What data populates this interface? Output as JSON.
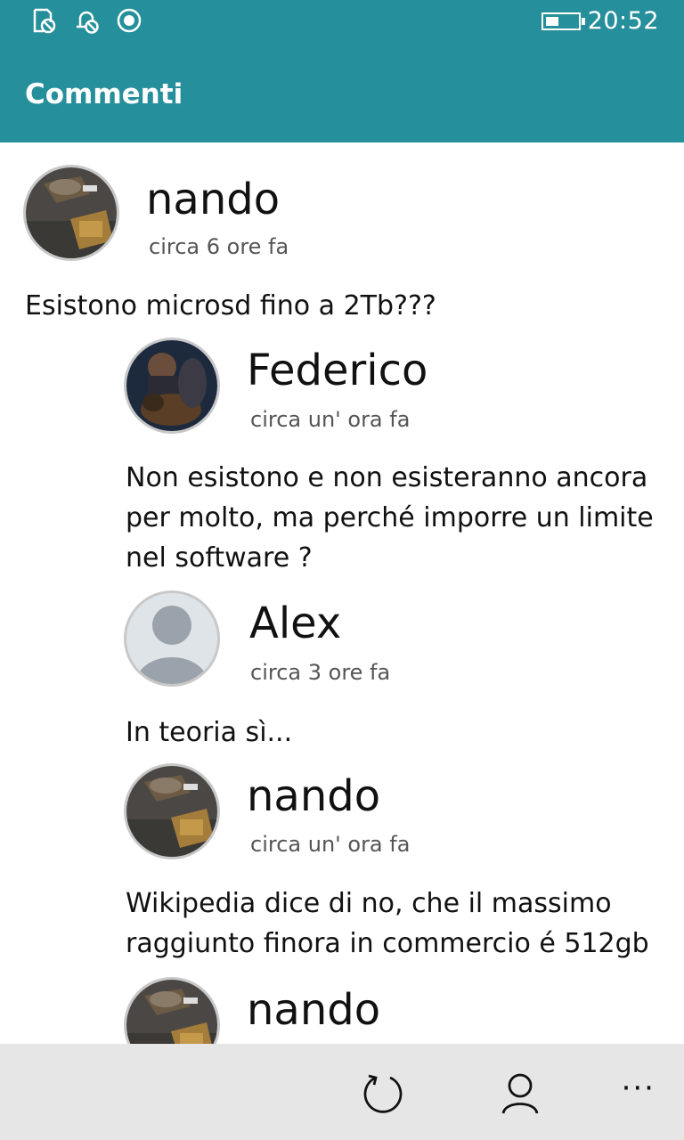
{
  "status_bar": {
    "time": "20:52",
    "icons": [
      "alarm-off-icon",
      "notification-off-icon",
      "record-icon",
      "battery-icon"
    ]
  },
  "app_bar": {
    "title": "Commenti"
  },
  "comments": [
    {
      "user": "nando",
      "time": "circa 6 ore fa",
      "text": "Esistono microsd fino a 2Tb???",
      "avatar": "photo-food-icon",
      "replies": [
        {
          "user": "Federico",
          "time": "circa un' ora fa",
          "text_lines": [
            "Non esistono e non esisteranno ancora",
            "per molto, ma perché imporre un limite",
            "nel software ?"
          ],
          "avatar": "photo-dog-icon"
        },
        {
          "user": "Alex",
          "time": "circa 3 ore fa",
          "text_lines": [
            "In teoria sì..."
          ],
          "avatar": "default-user-icon"
        },
        {
          "user": "nando",
          "time": "circa un' ora fa",
          "text_lines": [
            "Wikipedia dice di no, che il massimo",
            "raggiunto finora in commercio é 512gb"
          ],
          "avatar": "photo-food-icon"
        },
        {
          "user": "nando",
          "avatar": "photo-food-icon"
        }
      ]
    }
  ],
  "bottom_bar": {
    "icons": [
      "refresh-icon",
      "account-icon",
      "more-icon"
    ],
    "more_label": "···"
  },
  "colors": {
    "accent": "#258f9b",
    "bottom_bar": "#e6e6e6"
  }
}
